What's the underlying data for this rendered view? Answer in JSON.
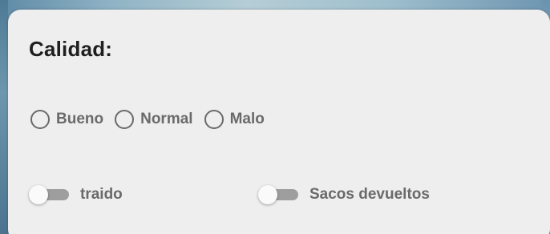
{
  "section": {
    "title": "Calidad:"
  },
  "quality_options": [
    {
      "label": "Bueno",
      "selected": false
    },
    {
      "label": "Normal",
      "selected": false
    },
    {
      "label": "Malo",
      "selected": false
    }
  ],
  "toggles": [
    {
      "label": "traido",
      "on": false
    },
    {
      "label": "Sacos devueltos",
      "on": false
    }
  ],
  "colors": {
    "card_background": "#eeeeee",
    "text_muted": "#6a6a6a",
    "title_text": "#1f1f1f",
    "switch_track_off": "#9e9e9e",
    "switch_thumb": "#fafafa"
  }
}
